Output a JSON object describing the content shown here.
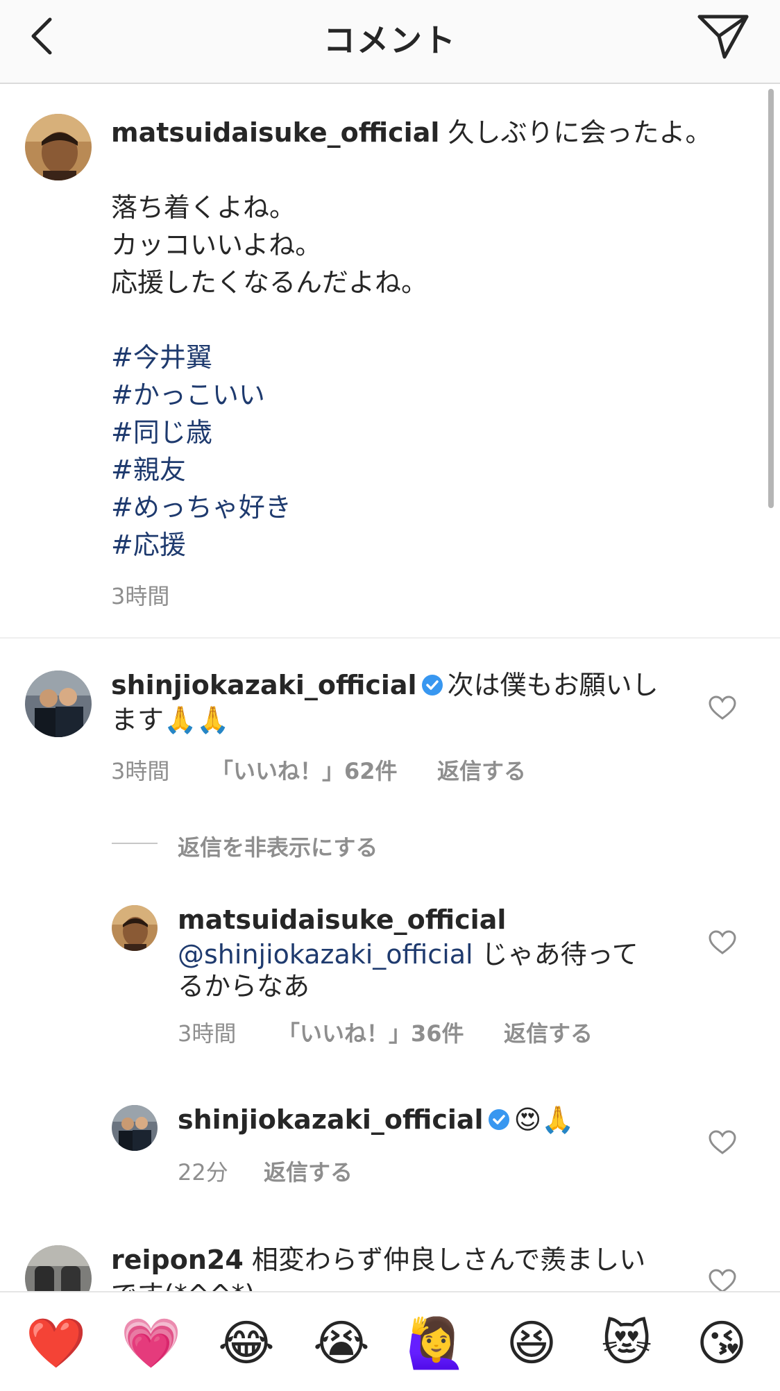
{
  "header": {
    "title": "コメント",
    "back_icon": "chevron-left-icon",
    "send_icon": "paper-plane-icon"
  },
  "caption": {
    "username": "matsuidaisuke_official",
    "first_line": "久しぶりに会ったよ。",
    "lines": [
      "落ち着くよね。",
      "カッコいいよね。",
      "応援したくなるんだよね。"
    ],
    "hashtags": [
      "#今井翼",
      "#かっこいい",
      "#同じ歳",
      "#親友",
      "#めっちゃ好き",
      "#応援"
    ],
    "time": "3時間"
  },
  "comments": [
    {
      "username": "shinjiokazaki_official",
      "verified": true,
      "text_line1": "次は僕もお願いし",
      "text_line2": "ます🙏🙏",
      "time": "3時間",
      "likes": "「いいね！」62件",
      "reply": "返信する",
      "hide_replies": "返信を非表示にする"
    },
    {
      "username": "matsuidaisuke_official",
      "mention": "@shinjiokazaki_official",
      "text_line1": " じゃあ待って",
      "text_line2": "るからなあ",
      "time": "3時間",
      "likes": "「いいね！」36件",
      "reply": "返信する"
    },
    {
      "username": "shinjiokazaki_official",
      "verified": true,
      "text": "😍🙏",
      "time": "22分",
      "reply": "返信する"
    },
    {
      "username": "reipon24",
      "text_line1": "相変わらず仲良しさんで羨ましい",
      "text_line2": "です(*^^*)"
    }
  ],
  "emoji_bar": [
    "❤️",
    "💗",
    "😂",
    "😭",
    "🙋‍♀️",
    "😆",
    "😻",
    "😘"
  ],
  "colors": {
    "hashtag": "#1e3a6e",
    "verified": "#3897f0",
    "meta_gray": "#8e8e8e",
    "header_bg": "#fafafa"
  }
}
